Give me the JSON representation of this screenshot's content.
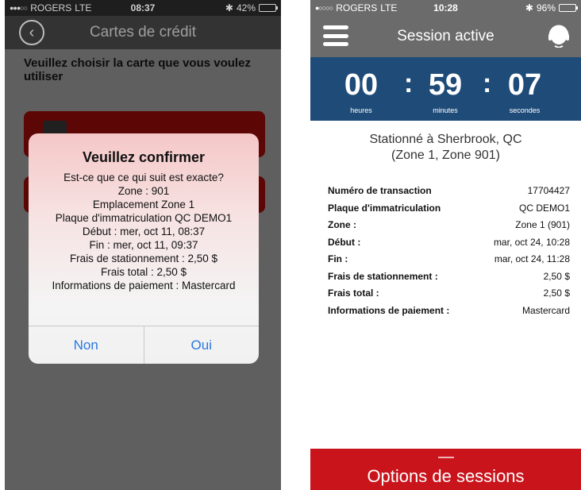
{
  "left_phone": {
    "status": {
      "carrier": "ROGERS",
      "network": "LTE",
      "time": "08:37",
      "battery": "42%",
      "battery_level": 0.42
    },
    "header": {
      "title": "Cartes de crédit"
    },
    "instruction": "Veuillez  choisir la carte que vous voulez utiliser",
    "dialog": {
      "title": "Veuillez confirmer",
      "lines": [
        "Est-ce que ce qui suit est exacte?",
        "Zone : 901",
        "Emplacement  Zone 1",
        "Plaque d'immatriculation QC DEMO1",
        "Début : mer, oct 11, 08:37",
        "Fin : mer, oct 11, 09:37",
        "Frais de stationnement : 2,50 $",
        "Frais total : 2,50 $",
        "Informations de paiement : Mastercard"
      ],
      "no_label": "Non",
      "yes_label": "Oui"
    }
  },
  "right_phone": {
    "status": {
      "carrier": "ROGERS",
      "network": "LTE",
      "time": "10:28",
      "battery": "96%",
      "battery_level": 0.96
    },
    "header": {
      "title": "Session active"
    },
    "timer": {
      "hours": "00",
      "minutes": "59",
      "seconds": "07",
      "hours_label": "heures",
      "minutes_label": "minutes",
      "seconds_label": "secondes"
    },
    "location_line1": "Stationné à Sherbrook, QC",
    "location_line2": "(Zone 1, Zone 901)",
    "details": [
      {
        "label": "Numéro de transaction",
        "value": "17704427"
      },
      {
        "label": "Plaque d'immatriculation",
        "value": "QC DEMO1"
      },
      {
        "label": "Zone :",
        "value": "Zone 1 (901)"
      },
      {
        "label": "Début :",
        "value": "mar, oct 24, 10:28"
      },
      {
        "label": "Fin :",
        "value": "mar, oct 24, 11:28"
      },
      {
        "label": "Frais de stationnement :",
        "value": "2,50 $"
      },
      {
        "label": "Frais total :",
        "value": "2,50 $"
      },
      {
        "label": "Informations de paiement :",
        "value": "Mastercard"
      }
    ],
    "options_label": "Options de sessions"
  },
  "colors": {
    "left_background": "#5f5f5f",
    "card_red": "#5c0606",
    "timer_blue": "#1e4b78",
    "options_red": "#c9141c",
    "ios_blue": "#2a78e0"
  }
}
